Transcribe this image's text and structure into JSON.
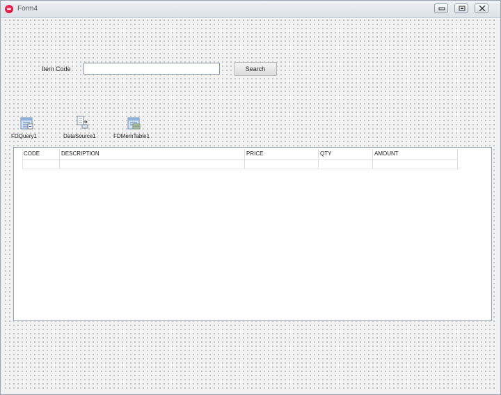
{
  "window": {
    "title": "Form4",
    "buttons": [
      "minimize",
      "maximize",
      "close"
    ]
  },
  "search": {
    "label": "Item Code",
    "value": "",
    "button_label": "Search"
  },
  "components": [
    {
      "name": "FDQuery1",
      "icon": "fdquery-icon"
    },
    {
      "name": "DataSource1",
      "icon": "datasource-icon"
    },
    {
      "name": "FDMemTable1",
      "icon": "fdmemtable-icon"
    }
  ],
  "grid": {
    "columns": [
      "CODE",
      "DESCRIPTION",
      "PRICE",
      "QTY",
      "AMOUNT"
    ],
    "rows": []
  }
}
